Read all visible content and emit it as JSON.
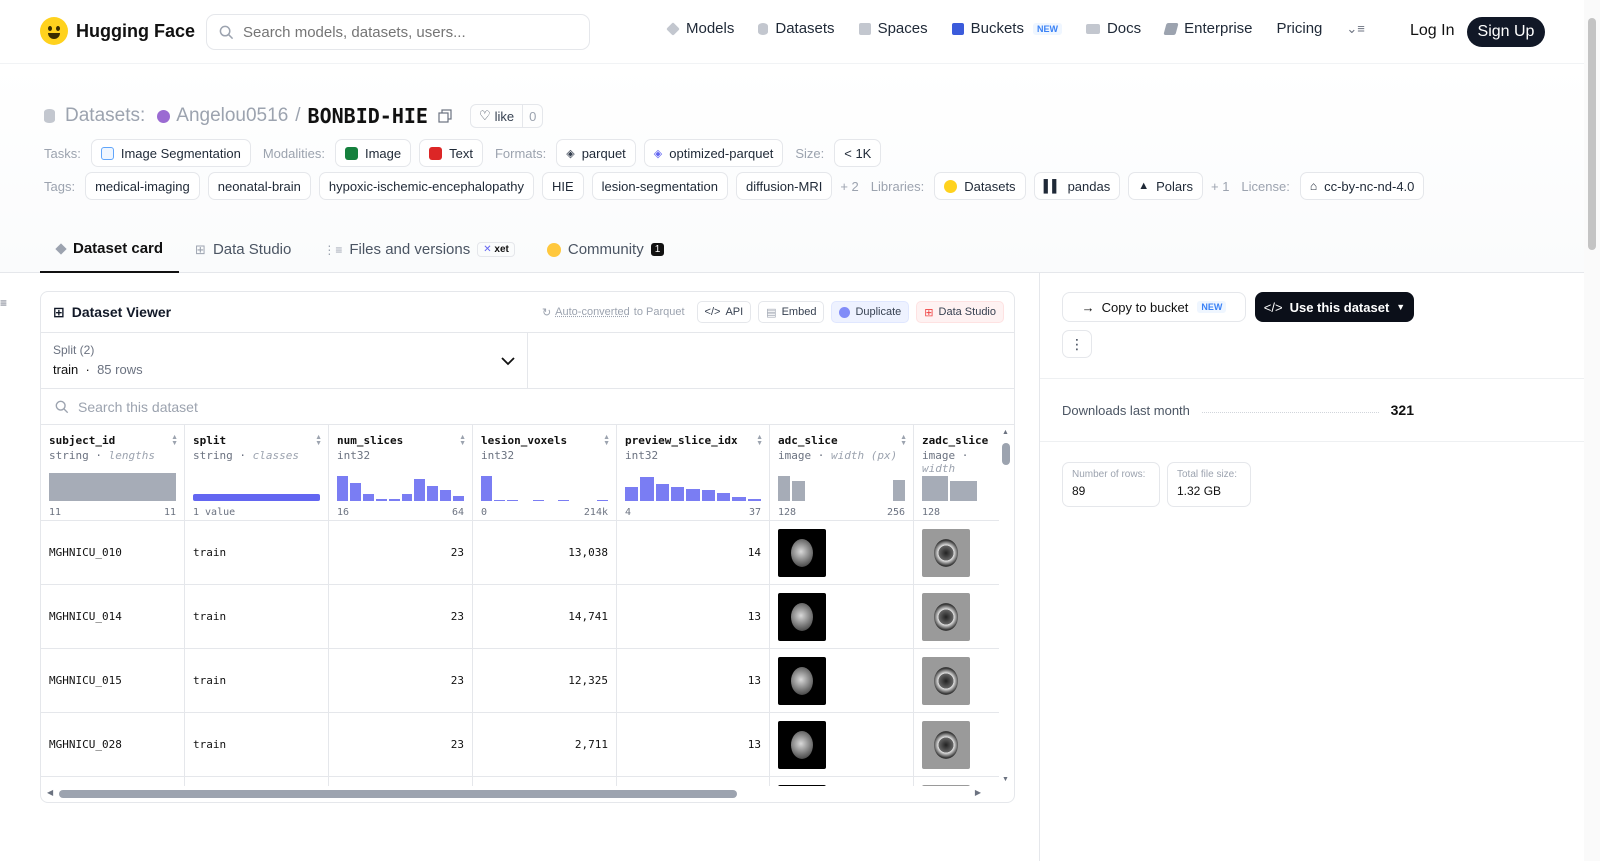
{
  "header": {
    "brand": "Hugging Face",
    "search_placeholder": "Search models, datasets, users...",
    "nav": [
      {
        "label": "Models",
        "icon": "model-icon",
        "color": "#9ca3af"
      },
      {
        "label": "Datasets",
        "icon": "dataset-icon",
        "color": "#9ca3af"
      },
      {
        "label": "Spaces",
        "icon": "spaces-icon",
        "color": "#9ca3af"
      },
      {
        "label": "Buckets",
        "icon": "bucket-icon",
        "color": "#3b5bdb",
        "badge": "NEW"
      },
      {
        "label": "Docs",
        "icon": "docs-icon",
        "color": "#9ca3af"
      },
      {
        "label": "Enterprise",
        "icon": "enterprise-icon",
        "color": "#9ca3af"
      },
      {
        "label": "Pricing"
      }
    ],
    "login": "Log In",
    "signup": "Sign Up"
  },
  "repo": {
    "kind": "Datasets:",
    "owner": "Angelou0516",
    "name": "BONBID-HIE",
    "like_label": "like",
    "like_count": "0"
  },
  "meta": {
    "tasks_label": "Tasks:",
    "task": "Image Segmentation",
    "modalities_label": "Modalities:",
    "modalities": [
      "Image",
      "Text"
    ],
    "formats_label": "Formats:",
    "formats": [
      "parquet",
      "optimized-parquet"
    ],
    "size_label": "Size:",
    "size": "< 1K",
    "tags_label": "Tags:",
    "tags": [
      "medical-imaging",
      "neonatal-brain",
      "hypoxic-ischemic-encephalopathy",
      "HIE",
      "lesion-segmentation",
      "diffusion-MRI"
    ],
    "tags_more": "+ 2",
    "libraries_label": "Libraries:",
    "libraries": [
      "Datasets",
      "pandas",
      "Polars"
    ],
    "libraries_more": "+ 1",
    "license_label": "License:",
    "license": "cc-by-nc-nd-4.0"
  },
  "tabs": [
    {
      "label": "Dataset card",
      "active": true
    },
    {
      "label": "Data Studio"
    },
    {
      "label": "Files and versions",
      "badge": "xet"
    },
    {
      "label": "Community",
      "count": "1"
    }
  ],
  "viewer": {
    "title": "Dataset Viewer",
    "auto_converted": "Auto-converted",
    "to_parquet": "to Parquet",
    "buttons": [
      "API",
      "Embed",
      "Duplicate",
      "Data Studio"
    ],
    "split_label": "Split (2)",
    "split_value": "train",
    "split_rows": "85 rows",
    "search_placeholder": "Search this dataset",
    "columns": [
      {
        "name": "subject_id",
        "type": "string",
        "stat": "lengths",
        "min": "11",
        "max": "11",
        "hist": [
          1
        ],
        "hist_kind": "grey"
      },
      {
        "name": "split",
        "type": "string",
        "stat": "classes",
        "min": "1 value",
        "max": "",
        "hist": [],
        "hist_kind": "class"
      },
      {
        "name": "num_slices",
        "type": "int32",
        "stat": "",
        "min": "16",
        "max": "64",
        "hist": [
          0.9,
          0.65,
          0.25,
          0.08,
          0.08,
          0.25,
          0.8,
          0.55,
          0.38,
          0.18
        ],
        "hist_kind": "bar"
      },
      {
        "name": "lesion_voxels",
        "type": "int32",
        "stat": "",
        "min": "0",
        "max": "214k",
        "hist": [
          0.9,
          0.05,
          0.05,
          0.0,
          0.03,
          0.0,
          0.03,
          0.0,
          0.0,
          0.03
        ],
        "hist_kind": "bar"
      },
      {
        "name": "preview_slice_idx",
        "type": "int32",
        "stat": "",
        "min": "4",
        "max": "37",
        "hist": [
          0.5,
          0.85,
          0.6,
          0.5,
          0.42,
          0.38,
          0.3,
          0.15,
          0.08
        ],
        "hist_kind": "bar"
      },
      {
        "name": "adc_slice",
        "type": "image",
        "stat": "width (px)",
        "min": "128",
        "max": "256",
        "hist": [
          0.9,
          0.7,
          0.0,
          0.0,
          0.0,
          0.0,
          0.0,
          0.0,
          0.75
        ],
        "hist_kind": "grey"
      },
      {
        "name": "zadc_slice",
        "type": "image",
        "stat": "width",
        "min": "128",
        "max": "",
        "hist": [
          0.9,
          0.7,
          0.0
        ],
        "hist_kind": "grey"
      }
    ],
    "rows": [
      {
        "subject_id": "MGHNICU_010",
        "split": "train",
        "num_slices": "23",
        "lesion_voxels": "13,038",
        "preview_slice_idx": "14"
      },
      {
        "subject_id": "MGHNICU_014",
        "split": "train",
        "num_slices": "23",
        "lesion_voxels": "14,741",
        "preview_slice_idx": "13"
      },
      {
        "subject_id": "MGHNICU_015",
        "split": "train",
        "num_slices": "23",
        "lesion_voxels": "12,325",
        "preview_slice_idx": "13"
      },
      {
        "subject_id": "MGHNICU_028",
        "split": "train",
        "num_slices": "23",
        "lesion_voxels": "2,711",
        "preview_slice_idx": "13"
      }
    ]
  },
  "sidebar": {
    "copy_bucket": "Copy to bucket",
    "copy_badge": "NEW",
    "use_dataset": "Use this dataset",
    "downloads_label": "Downloads last month",
    "downloads": "321",
    "rows_label": "Number of rows:",
    "rows_value": "89",
    "size_label": "Total file size:",
    "size_value": "1.32 GB"
  }
}
